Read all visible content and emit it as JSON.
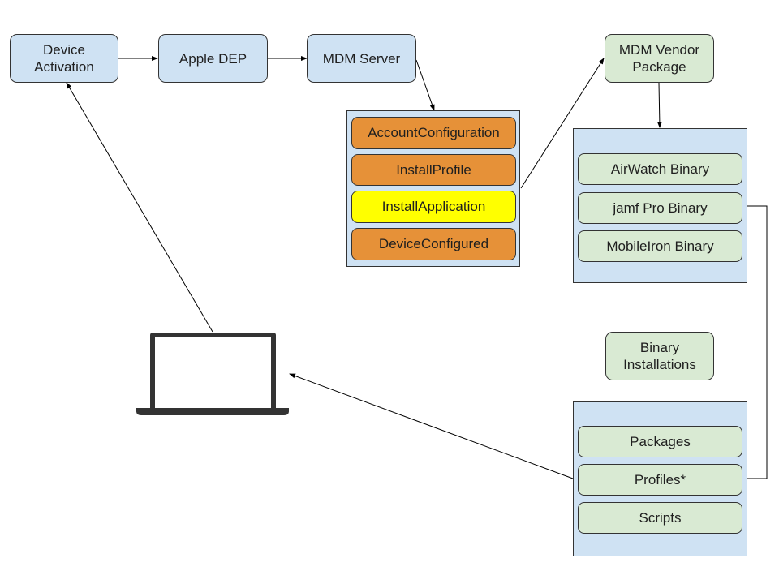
{
  "flow": {
    "device_activation": "Device\nActivation",
    "apple_dep": "Apple DEP",
    "mdm_server": "MDM Server"
  },
  "mdm_commands": {
    "items": [
      {
        "label": "AccountConfiguration",
        "color": "#e69138"
      },
      {
        "label": "InstallProfile",
        "color": "#e69138"
      },
      {
        "label": "InstallApplication",
        "color": "#ffff00"
      },
      {
        "label": "DeviceConfigured",
        "color": "#e69138"
      }
    ]
  },
  "vendor": {
    "package_label": "MDM Vendor\nPackage",
    "binaries": [
      {
        "label": "AirWatch Binary"
      },
      {
        "label": "jamf Pro Binary"
      },
      {
        "label": "MobileIron Binary"
      }
    ]
  },
  "binary_installations": {
    "label": "Binary\nInstallations",
    "items": [
      {
        "label": "Packages"
      },
      {
        "label": "Profiles*"
      },
      {
        "label": "Scripts"
      }
    ]
  },
  "device": {
    "icon": "laptop-icon"
  },
  "colors": {
    "blue_fill": "#cfe2f3",
    "green_fill": "#d9ead3",
    "orange_fill": "#e69138",
    "yellow_fill": "#ffff00",
    "outline": "#333333"
  }
}
